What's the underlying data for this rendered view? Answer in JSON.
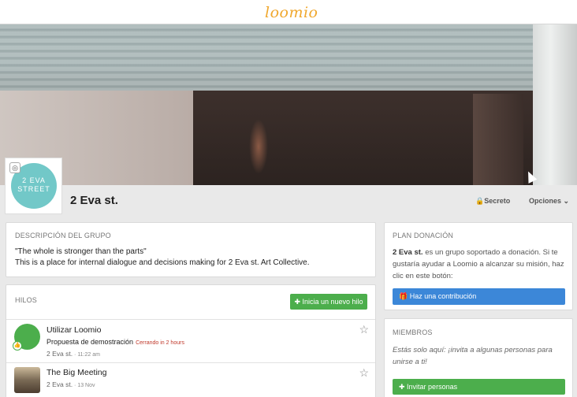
{
  "app": {
    "logo": "loomio"
  },
  "group": {
    "avatar_line1": "2 EVA",
    "avatar_line2": "STREET",
    "name": "2 Eva st.",
    "privacy": "Secreto",
    "options": "Opciones"
  },
  "description": {
    "label": "DESCRIPCIÓN DEL GRUPO",
    "line1": "\"The whole is stronger than the parts\"",
    "line2": "This is a place for internal dialogue and decisions making for 2 Eva st. Art Collective."
  },
  "threads": {
    "label": "HILOS",
    "new_button": "Inicia un nuevo hilo",
    "items": [
      {
        "title": "Utilizar Loomio",
        "subtitle": "Propuesta de demostración",
        "closing": "Cerrando in 2 hours",
        "group": "2 Eva st.",
        "time": "11:22 am"
      },
      {
        "title": "The Big Meeting",
        "group": "2 Eva st.",
        "time": "13 Nov"
      }
    ]
  },
  "plan": {
    "label": "PLAN DONACIÓN",
    "group_name": "2 Eva st.",
    "text": " es un grupo soportado a donación. Si te gustaría ayudar a Loomio a alcanzar su misión, haz clic en este botón:",
    "button": "Haz una contribución"
  },
  "members": {
    "label": "MIEMBROS",
    "text": "Estás solo aquí: ¡invita a algunas personas para unirse a ti!",
    "button": "Invitar personas"
  },
  "colors": {
    "accent_green": "#4cae4c",
    "accent_blue": "#3c87d8",
    "logo": "#f0a82e",
    "avatar": "#72c8c8"
  }
}
